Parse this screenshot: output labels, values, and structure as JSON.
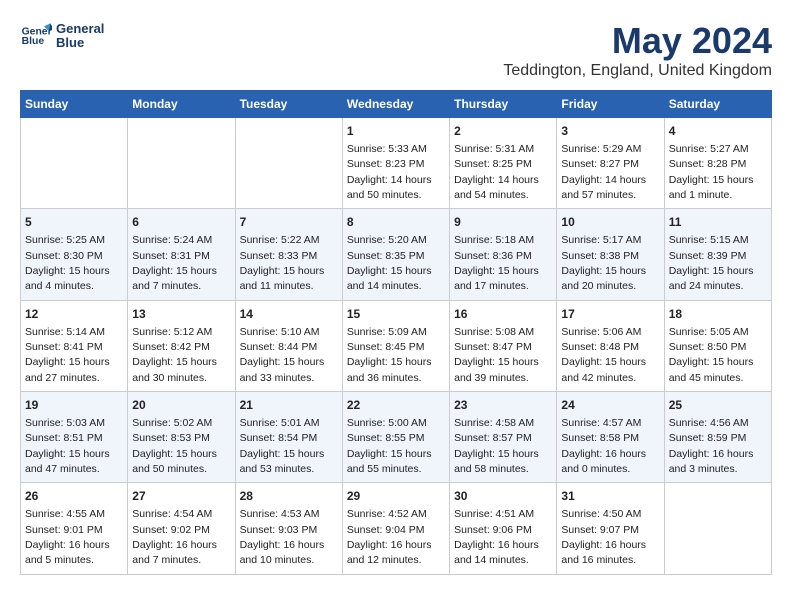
{
  "header": {
    "logo_line1": "General",
    "logo_line2": "Blue",
    "title": "May 2024",
    "subtitle": "Teddington, England, United Kingdom"
  },
  "weekdays": [
    "Sunday",
    "Monday",
    "Tuesday",
    "Wednesday",
    "Thursday",
    "Friday",
    "Saturday"
  ],
  "weeks": [
    [
      {
        "day": "",
        "info": ""
      },
      {
        "day": "",
        "info": ""
      },
      {
        "day": "",
        "info": ""
      },
      {
        "day": "1",
        "info": "Sunrise: 5:33 AM\nSunset: 8:23 PM\nDaylight: 14 hours\nand 50 minutes."
      },
      {
        "day": "2",
        "info": "Sunrise: 5:31 AM\nSunset: 8:25 PM\nDaylight: 14 hours\nand 54 minutes."
      },
      {
        "day": "3",
        "info": "Sunrise: 5:29 AM\nSunset: 8:27 PM\nDaylight: 14 hours\nand 57 minutes."
      },
      {
        "day": "4",
        "info": "Sunrise: 5:27 AM\nSunset: 8:28 PM\nDaylight: 15 hours\nand 1 minute."
      }
    ],
    [
      {
        "day": "5",
        "info": "Sunrise: 5:25 AM\nSunset: 8:30 PM\nDaylight: 15 hours\nand 4 minutes."
      },
      {
        "day": "6",
        "info": "Sunrise: 5:24 AM\nSunset: 8:31 PM\nDaylight: 15 hours\nand 7 minutes."
      },
      {
        "day": "7",
        "info": "Sunrise: 5:22 AM\nSunset: 8:33 PM\nDaylight: 15 hours\nand 11 minutes."
      },
      {
        "day": "8",
        "info": "Sunrise: 5:20 AM\nSunset: 8:35 PM\nDaylight: 15 hours\nand 14 minutes."
      },
      {
        "day": "9",
        "info": "Sunrise: 5:18 AM\nSunset: 8:36 PM\nDaylight: 15 hours\nand 17 minutes."
      },
      {
        "day": "10",
        "info": "Sunrise: 5:17 AM\nSunset: 8:38 PM\nDaylight: 15 hours\nand 20 minutes."
      },
      {
        "day": "11",
        "info": "Sunrise: 5:15 AM\nSunset: 8:39 PM\nDaylight: 15 hours\nand 24 minutes."
      }
    ],
    [
      {
        "day": "12",
        "info": "Sunrise: 5:14 AM\nSunset: 8:41 PM\nDaylight: 15 hours\nand 27 minutes."
      },
      {
        "day": "13",
        "info": "Sunrise: 5:12 AM\nSunset: 8:42 PM\nDaylight: 15 hours\nand 30 minutes."
      },
      {
        "day": "14",
        "info": "Sunrise: 5:10 AM\nSunset: 8:44 PM\nDaylight: 15 hours\nand 33 minutes."
      },
      {
        "day": "15",
        "info": "Sunrise: 5:09 AM\nSunset: 8:45 PM\nDaylight: 15 hours\nand 36 minutes."
      },
      {
        "day": "16",
        "info": "Sunrise: 5:08 AM\nSunset: 8:47 PM\nDaylight: 15 hours\nand 39 minutes."
      },
      {
        "day": "17",
        "info": "Sunrise: 5:06 AM\nSunset: 8:48 PM\nDaylight: 15 hours\nand 42 minutes."
      },
      {
        "day": "18",
        "info": "Sunrise: 5:05 AM\nSunset: 8:50 PM\nDaylight: 15 hours\nand 45 minutes."
      }
    ],
    [
      {
        "day": "19",
        "info": "Sunrise: 5:03 AM\nSunset: 8:51 PM\nDaylight: 15 hours\nand 47 minutes."
      },
      {
        "day": "20",
        "info": "Sunrise: 5:02 AM\nSunset: 8:53 PM\nDaylight: 15 hours\nand 50 minutes."
      },
      {
        "day": "21",
        "info": "Sunrise: 5:01 AM\nSunset: 8:54 PM\nDaylight: 15 hours\nand 53 minutes."
      },
      {
        "day": "22",
        "info": "Sunrise: 5:00 AM\nSunset: 8:55 PM\nDaylight: 15 hours\nand 55 minutes."
      },
      {
        "day": "23",
        "info": "Sunrise: 4:58 AM\nSunset: 8:57 PM\nDaylight: 15 hours\nand 58 minutes."
      },
      {
        "day": "24",
        "info": "Sunrise: 4:57 AM\nSunset: 8:58 PM\nDaylight: 16 hours\nand 0 minutes."
      },
      {
        "day": "25",
        "info": "Sunrise: 4:56 AM\nSunset: 8:59 PM\nDaylight: 16 hours\nand 3 minutes."
      }
    ],
    [
      {
        "day": "26",
        "info": "Sunrise: 4:55 AM\nSunset: 9:01 PM\nDaylight: 16 hours\nand 5 minutes."
      },
      {
        "day": "27",
        "info": "Sunrise: 4:54 AM\nSunset: 9:02 PM\nDaylight: 16 hours\nand 7 minutes."
      },
      {
        "day": "28",
        "info": "Sunrise: 4:53 AM\nSunset: 9:03 PM\nDaylight: 16 hours\nand 10 minutes."
      },
      {
        "day": "29",
        "info": "Sunrise: 4:52 AM\nSunset: 9:04 PM\nDaylight: 16 hours\nand 12 minutes."
      },
      {
        "day": "30",
        "info": "Sunrise: 4:51 AM\nSunset: 9:06 PM\nDaylight: 16 hours\nand 14 minutes."
      },
      {
        "day": "31",
        "info": "Sunrise: 4:50 AM\nSunset: 9:07 PM\nDaylight: 16 hours\nand 16 minutes."
      },
      {
        "day": "",
        "info": ""
      }
    ]
  ]
}
